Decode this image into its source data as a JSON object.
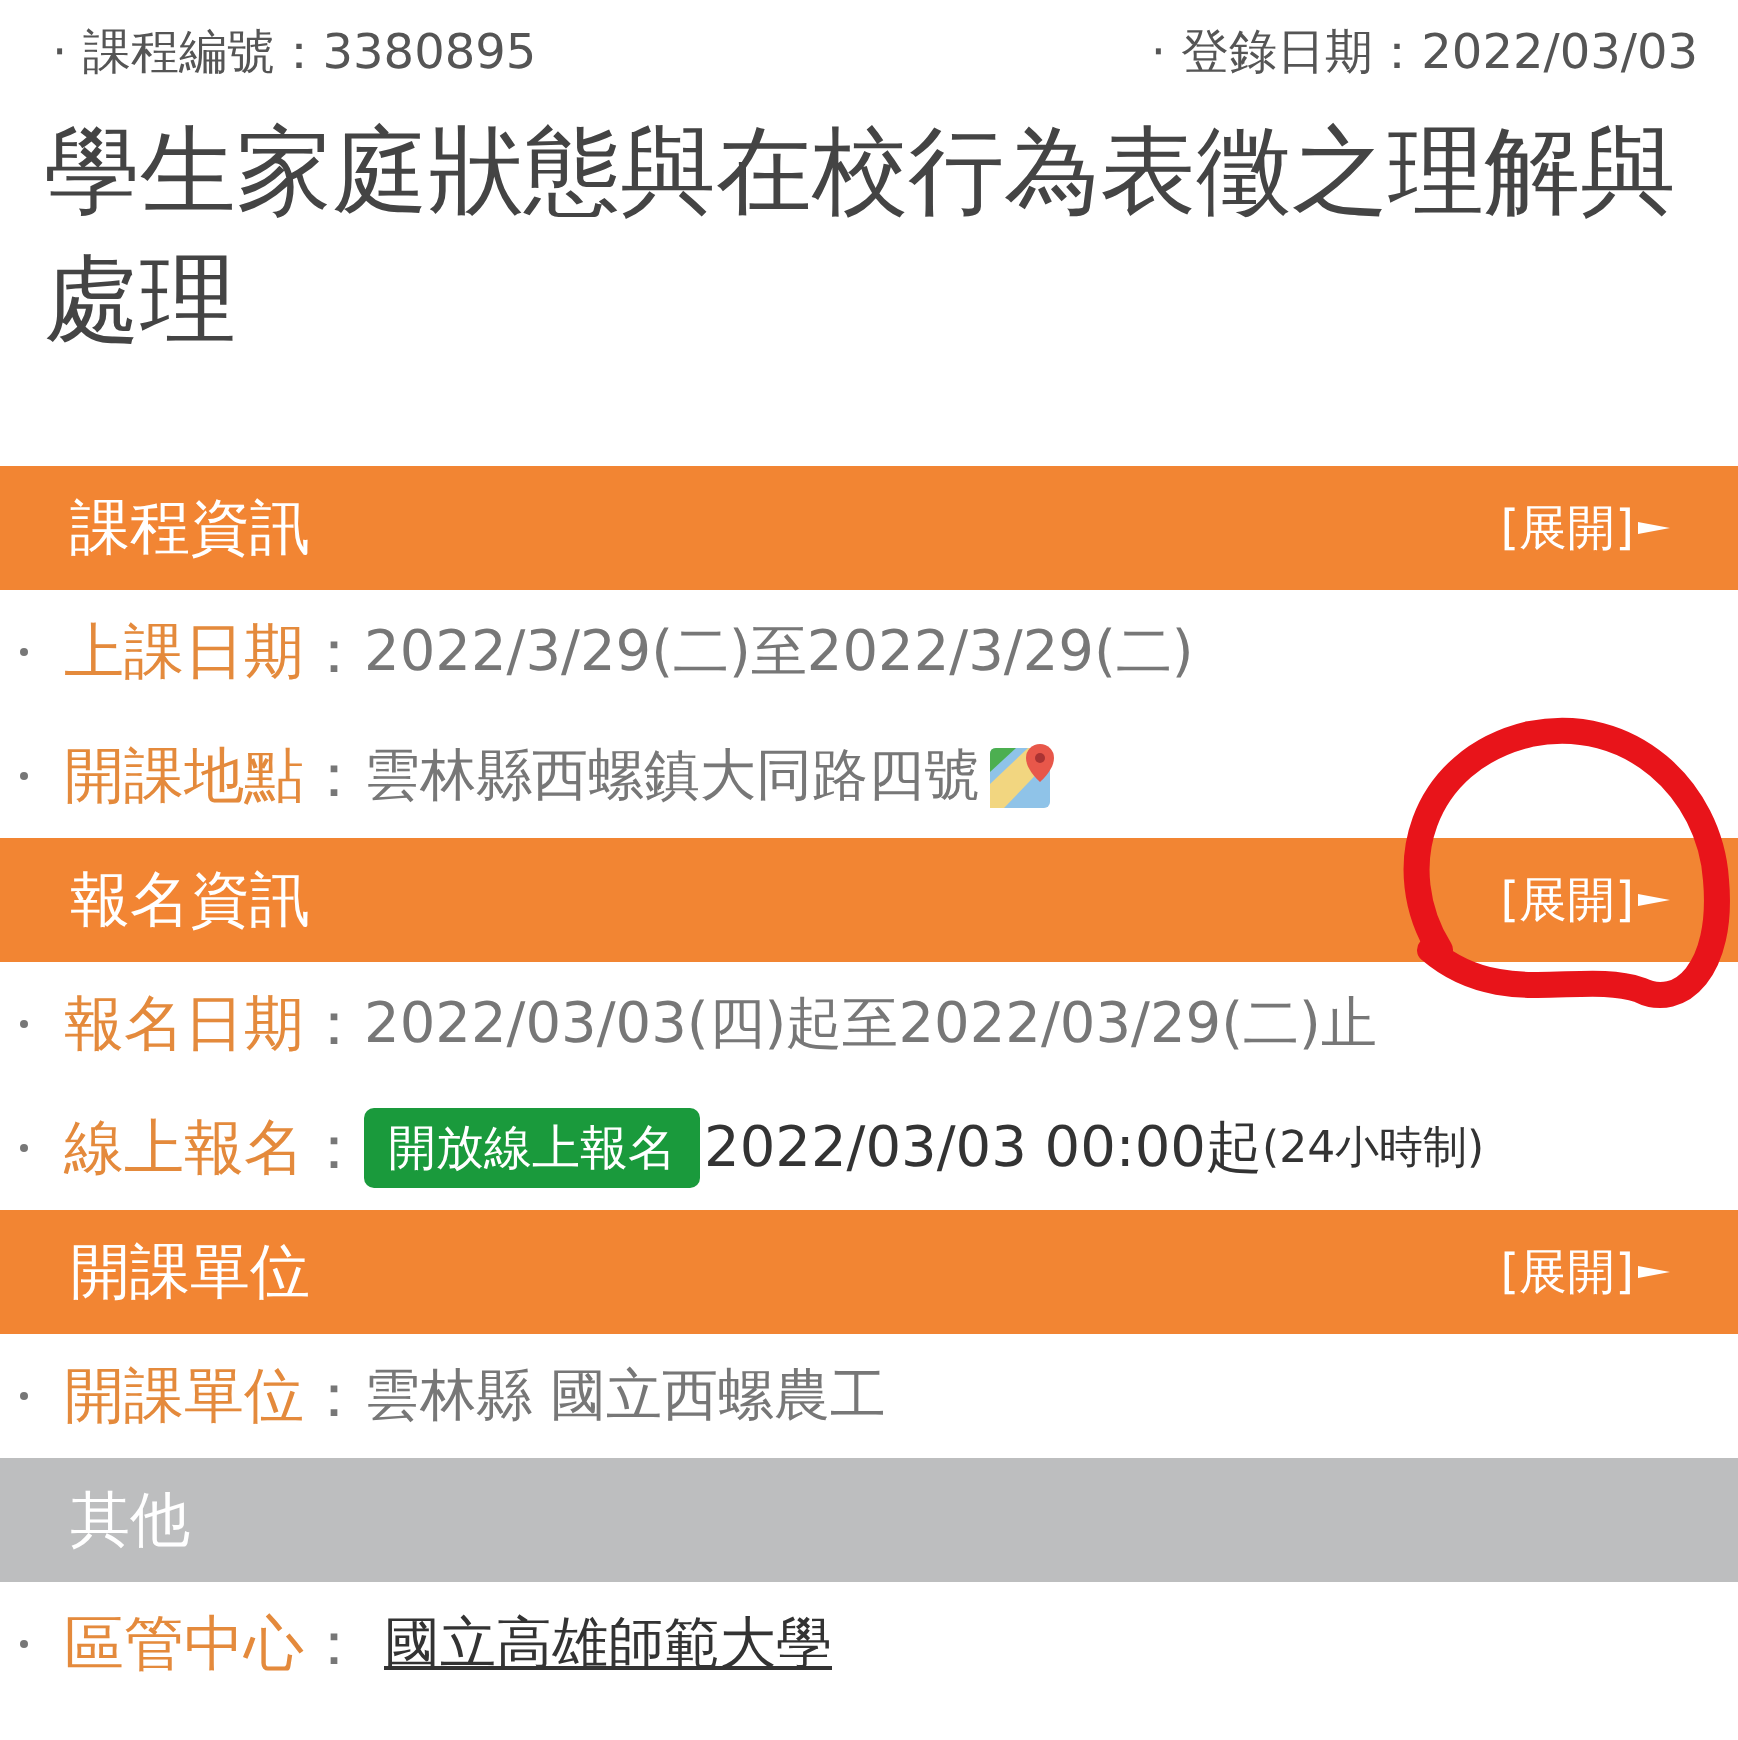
{
  "meta": [
    {
      "label": "· 課程編號：",
      "value": "3380895"
    },
    {
      "label": "· 登錄日期：",
      "value": "2022/03/03"
    }
  ],
  "title": "學生家庭狀態與在校行為表徵之理解與處理",
  "sections": [
    {
      "title": "課程資訊",
      "kind": "accent",
      "toggle": "[展開]",
      "rows": [
        {
          "kind": "text",
          "label": "上課日期",
          "sep": "：",
          "value": "2022/3/29(二)至2022/3/29(二)"
        },
        {
          "kind": "map",
          "label": "開課地點",
          "sep": "：",
          "value": "雲林縣西螺鎮大同路四號"
        }
      ]
    },
    {
      "title": "報名資訊",
      "kind": "accent",
      "toggle": "[展開]",
      "rows": [
        {
          "kind": "text",
          "label": "報名日期",
          "sep": "：",
          "value": "2022/03/03(四)起至2022/03/29(二)止"
        },
        {
          "kind": "badge",
          "label": "線上報名",
          "sep": "：",
          "badge": "開放線上報名",
          "value": "2022/03/03 00:00起",
          "note": "(24小時制)"
        }
      ]
    },
    {
      "title": "開課單位",
      "kind": "accent",
      "toggle": "[展開]",
      "rows": [
        {
          "kind": "text",
          "label": "開課單位",
          "sep": "：",
          "value": "雲林縣 國立西螺農工"
        }
      ]
    },
    {
      "title": "其他",
      "kind": "muted",
      "rows": [
        {
          "kind": "link",
          "label": "區管中心",
          "sep": "：",
          "value": "國立高雄師範大學"
        }
      ]
    }
  ],
  "annotation": {
    "kind": "circle",
    "color": "#e8141a"
  }
}
